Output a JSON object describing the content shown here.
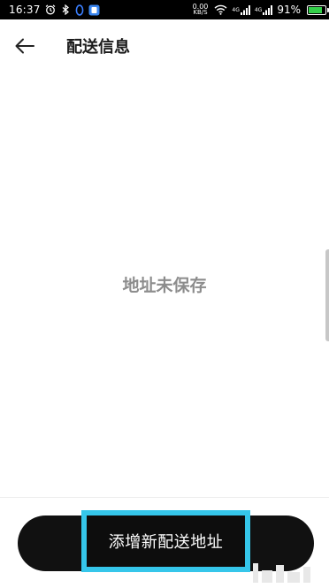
{
  "status_bar": {
    "time": "16:37",
    "speed_value": "0.00",
    "speed_unit": "KB/S",
    "network_4g_a": "4G",
    "network_4g_b": "4G",
    "battery_percent": "91%",
    "battery_level": 0.91,
    "battery_color": "#34d04a",
    "icons": [
      "alarm-icon",
      "bluetooth-icon",
      "sync-icon",
      "app-notification-icon",
      "wifi-icon",
      "signal-icon",
      "battery-icon"
    ]
  },
  "header": {
    "back_icon": "arrow-left-icon",
    "title": "配送信息"
  },
  "main": {
    "empty_message": "地址未保存"
  },
  "footer": {
    "add_button_label": "添增新配送地址",
    "highlight_color": "#35c6ea",
    "button_color": "#111111"
  }
}
